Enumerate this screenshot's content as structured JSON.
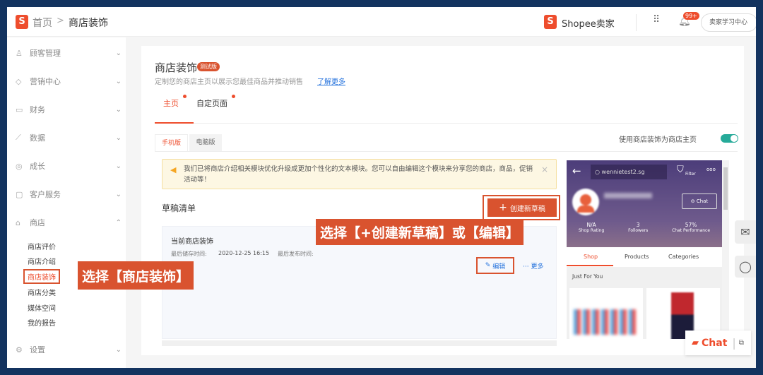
{
  "header": {
    "breadcrumb_home": "首页",
    "breadcrumb_sep": ">",
    "breadcrumb_current": "商店装饰",
    "brand": "Shopee卖家",
    "notif_badge": "99+",
    "learning_center": "卖家学习中心"
  },
  "sidebar": {
    "items": [
      {
        "label": "顾客管理",
        "icon": "user-icon"
      },
      {
        "label": "营销中心",
        "icon": "tag-icon"
      },
      {
        "label": "财务",
        "icon": "wallet-icon"
      },
      {
        "label": "数据",
        "icon": "chart-icon"
      },
      {
        "label": "成长",
        "icon": "badge-icon"
      },
      {
        "label": "客户服务",
        "icon": "message-icon"
      },
      {
        "label": "商店",
        "icon": "store-icon"
      }
    ],
    "shop_sub": [
      "商店评价",
      "商店介绍",
      "商店装饰",
      "商店分类",
      "媒体空间",
      "我的报告"
    ],
    "settings": "设置"
  },
  "page": {
    "title": "商店装饰",
    "beta_badge": "测试版",
    "subtitle": "定制您的商店主页以展示您最佳商品并推动销售",
    "learn_more": "了解更多",
    "tabs": [
      "主页",
      "自定页面"
    ],
    "sub_tabs": [
      "手机版",
      "电脑版"
    ],
    "toggle_label": "使用商店装饰为商店主页",
    "toggle_on": true,
    "notice": "我们已将商店介绍相关模块优化升级成更加个性化的文本模块。您可以自由编辑这个模块来分享您的商店，商品，促销活动等！",
    "drafts_title": "草稿清单",
    "create_button": "创建新草稿",
    "draft": {
      "name": "当前商店装饰",
      "saved_label": "最后储存时间:",
      "saved_time": "2020-12-25 16:15",
      "published_label": "最后发布时间:",
      "edit": "编辑",
      "more": "更多"
    }
  },
  "preview": {
    "search": "wennietest2.sg",
    "filter": "Filter",
    "chat": "Chat",
    "stats": [
      {
        "value": "N/A",
        "label": "Shop Rating"
      },
      {
        "value": "3",
        "label": "Followers"
      },
      {
        "value": "57%",
        "label": "Chat Performance"
      }
    ],
    "tabs": [
      "Shop",
      "Products",
      "Categories"
    ],
    "section": "Just For You"
  },
  "callouts": {
    "create_or_edit": "选择【+创建新草稿】或【编辑】",
    "shop_decor": "选择【商店装饰】"
  },
  "chat_widget": "Chat",
  "colors": {
    "accent": "#ee4d2d",
    "callout": "#d9532f",
    "frame": "#13335f"
  }
}
